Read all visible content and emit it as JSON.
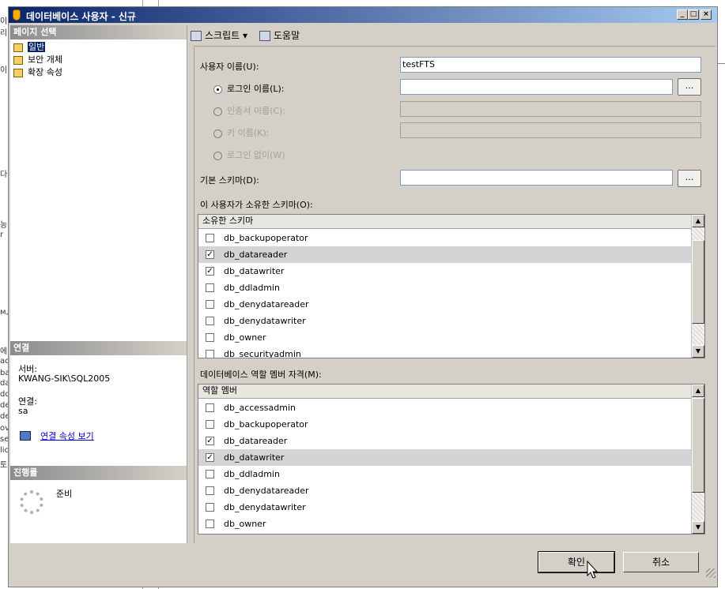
{
  "window": {
    "title": "데이터베이스 사용자 - 신규",
    "min": "_",
    "max": "□",
    "close": "×"
  },
  "background": {
    "chars": [
      "이",
      "리",
      "이",
      "다",
      "능",
      "r",
      "м,",
      "에",
      "ac",
      "ba",
      "da",
      "dd",
      "de",
      "de",
      "ov",
      "se",
      "lic",
      "토"
    ]
  },
  "left": {
    "page_select_header": "페이지 선택",
    "nav": [
      "일반",
      "보안 개체",
      "확장 속성"
    ],
    "connection_header": "연결",
    "server_label": "서버:",
    "server_value": "KWANG-SIK\\SQL2005",
    "conn_label": "연결:",
    "conn_value": "sa",
    "view_conn_props": "연결 속성 보기",
    "progress_header": "진행률",
    "progress_status": "준비"
  },
  "toolbar": {
    "script": "스크립트",
    "script_arrow": "▾",
    "help": "도움말"
  },
  "form": {
    "user_name_label": "사용자 이름(U):",
    "user_name_value": "testFTS",
    "login_name_label": "로그인 이름(L):",
    "cert_name_label": "인증서 이름(C):",
    "key_name_label": "키 이름(K):",
    "no_login_label": "로그인 없이(W)",
    "default_schema_label": "기본 스키마(D):",
    "browse": "...",
    "owned_schemas_label": "이 사용자가 소유한 스키마(O):",
    "owned_schemas_header": "소유한 스키마",
    "owned_schemas": [
      {
        "name": "db_backupoperator",
        "checked": false,
        "selected": false
      },
      {
        "name": "db_datareader",
        "checked": true,
        "selected": true
      },
      {
        "name": "db_datawriter",
        "checked": true,
        "selected": false
      },
      {
        "name": "db_ddladmin",
        "checked": false,
        "selected": false
      },
      {
        "name": "db_denydatareader",
        "checked": false,
        "selected": false
      },
      {
        "name": "db_denydatawriter",
        "checked": false,
        "selected": false
      },
      {
        "name": "db_owner",
        "checked": false,
        "selected": false
      },
      {
        "name": "db_securityadmin",
        "checked": false,
        "selected": false
      }
    ],
    "role_membership_label": "데이터베이스 역할 멤버 자격(M):",
    "role_header": "역할 멤버",
    "roles": [
      {
        "name": "db_accessadmin",
        "checked": false,
        "selected": false
      },
      {
        "name": "db_backupoperator",
        "checked": false,
        "selected": false
      },
      {
        "name": "db_datareader",
        "checked": true,
        "selected": false
      },
      {
        "name": "db_datawriter",
        "checked": true,
        "selected": true
      },
      {
        "name": "db_ddladmin",
        "checked": false,
        "selected": false
      },
      {
        "name": "db_denydatareader",
        "checked": false,
        "selected": false
      },
      {
        "name": "db_denydatawriter",
        "checked": false,
        "selected": false
      },
      {
        "name": "db_owner",
        "checked": false,
        "selected": false
      }
    ]
  },
  "buttons": {
    "ok": "확인",
    "cancel": "취소"
  }
}
